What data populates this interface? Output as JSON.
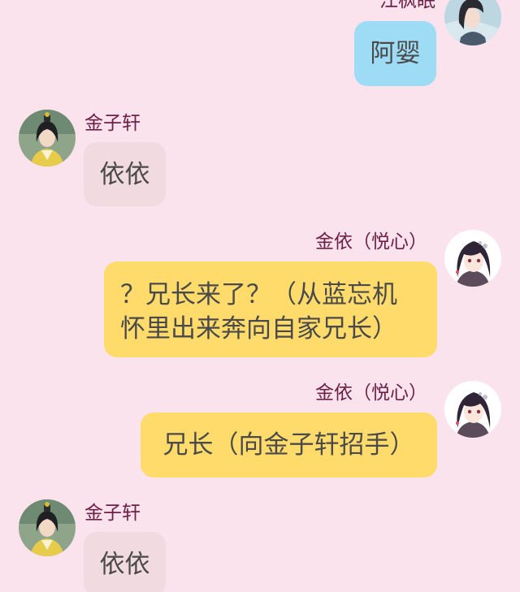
{
  "messages": [
    {
      "id": "m1",
      "side": "right",
      "sender": "江枫眠",
      "text": "阿婴",
      "bubble_color": "#9edcf6",
      "avatar_icon": "dark-haired-man-avatar-icon"
    },
    {
      "id": "m2",
      "side": "left",
      "sender": "金子轩",
      "text": "依依",
      "bubble_color": "#f1dbe1",
      "avatar_icon": "gold-robed-man-avatar-icon"
    },
    {
      "id": "m3",
      "side": "right",
      "sender": "金依（悦心）",
      "text": "？兄长来了？（从蓝忘机怀里出来奔向自家兄长）",
      "bubble_color": "#fedb6b",
      "avatar_icon": "girl-avatar-icon"
    },
    {
      "id": "m4",
      "side": "right",
      "sender": "金依（悦心）",
      "text": "兄长（向金子轩招手）",
      "bubble_color": "#fedb6b",
      "avatar_icon": "girl-avatar-icon"
    },
    {
      "id": "m5",
      "side": "left",
      "sender": "金子轩",
      "text": "依依",
      "bubble_color": "#f1dbe1",
      "avatar_icon": "gold-robed-man-avatar-icon"
    }
  ],
  "colors": {
    "background": "#fbe3ee",
    "sender_name": "#6e1f45",
    "message_text": "#4a4a4a"
  }
}
